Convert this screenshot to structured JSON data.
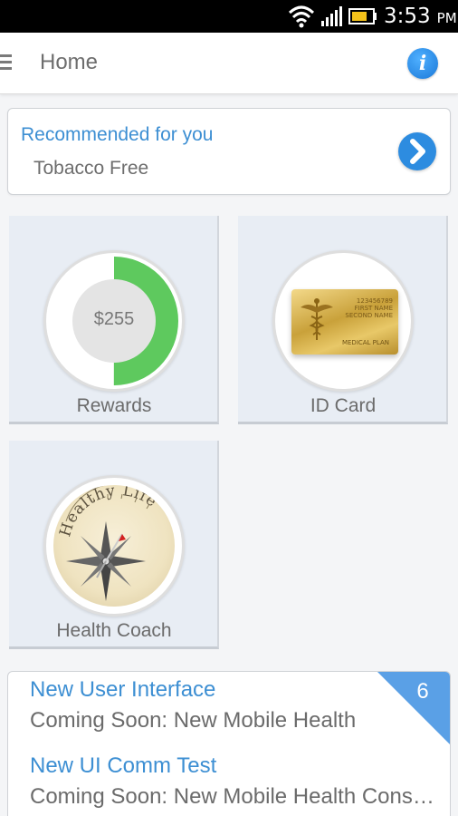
{
  "status_bar": {
    "time": "3:53",
    "ampm": "PM",
    "icons": [
      "wifi-icon",
      "signal-icon",
      "battery-icon"
    ]
  },
  "header": {
    "title": "Home",
    "menu_icon": "menu-icon",
    "info_icon": "info-icon",
    "info_glyph": "i"
  },
  "recommended": {
    "title": "Recommended for you",
    "item": "Tobacco Free",
    "arrow_icon": "chevron-right-icon"
  },
  "tiles": [
    {
      "label": "Rewards",
      "value": "$255",
      "progress_fraction": 0.5
    },
    {
      "label": "ID Card",
      "card_number": "123456789",
      "first_name": "FIRST NAME",
      "second_name": "SECOND NAME",
      "plan": "MEDICAL PLAN"
    },
    {
      "label": "Health Coach",
      "compass_text": "Healthy Life"
    }
  ],
  "messages": {
    "count": "6",
    "items": [
      {
        "title": "New User Interface",
        "body": "Coming Soon: New Mobile Health"
      },
      {
        "title": "New UI Comm Test",
        "body": "Coming Soon: New Mobile Health Consumer"
      }
    ]
  },
  "colors": {
    "accent_blue": "#3d8fd3",
    "progress_green": "#5ec95e",
    "badge_blue": "#5aa0e6",
    "tile_bg": "#e8edf4"
  }
}
